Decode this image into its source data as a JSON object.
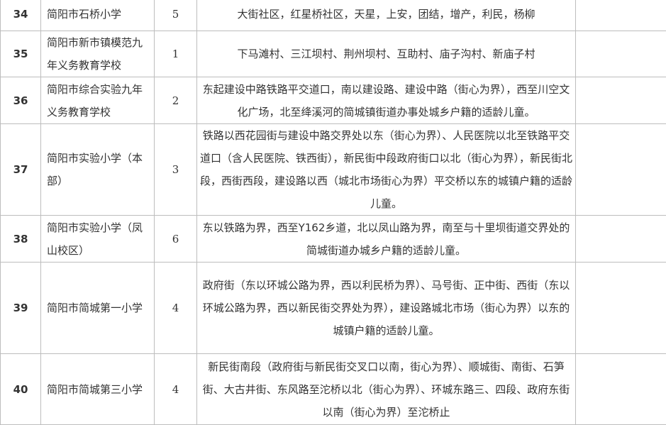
{
  "rows": [
    {
      "no": "34",
      "school": "简阳市石桥小学",
      "count": "5",
      "area": "大街社区，红星桥社区，天星，上安，团结，增产，利民，杨柳"
    },
    {
      "no": "35",
      "school": "简阳市新市镇模范九年义务教育学校",
      "count": "1",
      "area": "下马滩村、三江坝村、荆州坝村、互助村、庙子沟村、新庙子村"
    },
    {
      "no": "36",
      "school": "简阳市综合实验九年义务教育学校",
      "count": "2",
      "area": "东起建设中路铁路平交道口，南以建设路、建设中路（街心为界），西至川空文化广场，北至绛溪河的简城镇街道办事处城乡户籍的适龄儿童。"
    },
    {
      "no": "37",
      "school": "简阳市实验小学（本部）",
      "count": "3",
      "area": "铁路以西花园街与建设中路交界处以东（街心为界）、人民医院以北至铁路平交道口（含人民医院、铁西街），新民街中段政府街口以北（街心为界），新民街北段，西街西段，建设路以西（城北市场街心为界）平交桥以东的城镇户籍的适龄儿童。"
    },
    {
      "no": "38",
      "school": "简阳市实验小学（凤山校区）",
      "count": "6",
      "area": "东以铁路为界，西至Y162乡道，北以凤山路为界，南至与十里坝街道交界处的简城街道办城乡户籍的适龄儿童。"
    },
    {
      "no": "39",
      "school": "简阳市简城第一小学",
      "count": "4",
      "area": "政府街（东以环城公路为界，西以利民桥为界）、马号街、正中街、西街（东以环城公路为界，西以新民街交界处为界），建设路城北市场（街心为界）以东的城镇户籍的适龄儿童。"
    },
    {
      "no": "40",
      "school": "简阳市简城第三小学",
      "count": "4",
      "area": "新民街南段（政府街与新民街交叉口以南，街心为界）、顺城街、南街、石笋街、大古井街、东风路至沱桥以北（街心为界）、环城东路三、四段、政府东街以南（街心为界）至沱桥止"
    }
  ]
}
